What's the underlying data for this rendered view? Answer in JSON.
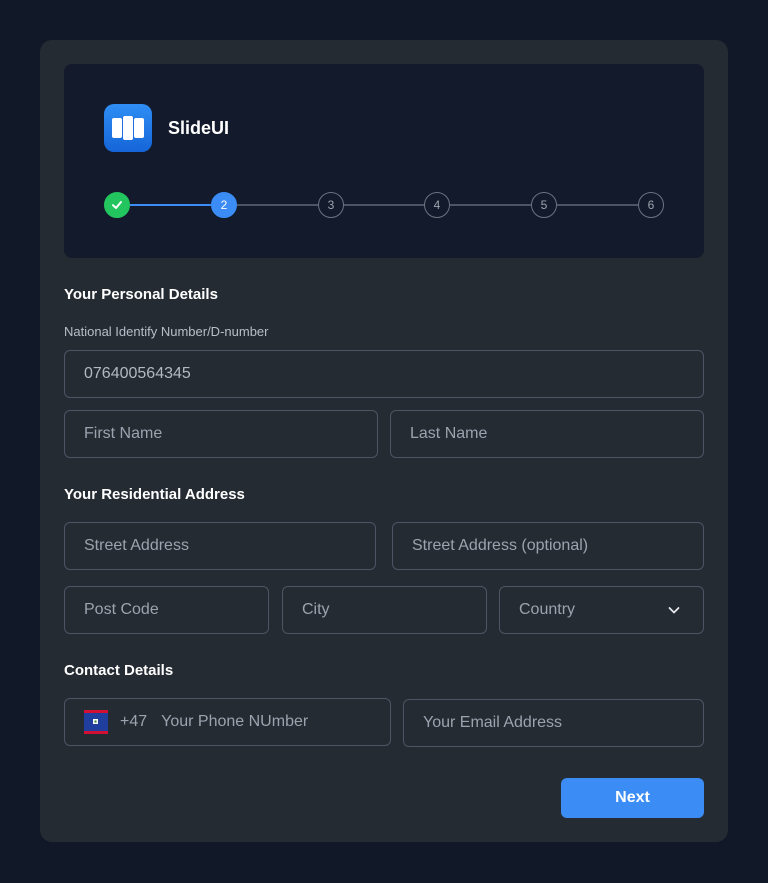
{
  "brand": {
    "name": "SlideUI",
    "icon": "slides-logo-icon",
    "color": "#1e7cf2"
  },
  "stepper": {
    "steps": [
      {
        "label": "",
        "state": "complete",
        "icon": "check-icon"
      },
      {
        "label": "2",
        "state": "active"
      },
      {
        "label": "3",
        "state": "pending"
      },
      {
        "label": "4",
        "state": "pending"
      },
      {
        "label": "5",
        "state": "pending"
      },
      {
        "label": "6",
        "state": "pending"
      }
    ]
  },
  "personal": {
    "title": "Your Personal Details",
    "nin_label": "National Identify Number/D-number",
    "nin_value": "076400564345",
    "first_name_placeholder": "First Name",
    "last_name_placeholder": "Last Name"
  },
  "address": {
    "title": "Your Residential Address",
    "street_placeholder": "Street Address",
    "street2_placeholder": "Street Address (optional)",
    "postcode_placeholder": "Post Code",
    "city_placeholder": "City",
    "country_placeholder": "Country"
  },
  "contact": {
    "title": "Contact Details",
    "country_code": "+47",
    "phone_placeholder": "Your Phone NUmber",
    "email_placeholder": "Your Email Address",
    "flag_icon": "flag-icon"
  },
  "actions": {
    "next_label": "Next"
  },
  "colors": {
    "accent": "#3b8cf5",
    "success": "#22c55e",
    "card": "#252b33",
    "page": "#111827"
  }
}
